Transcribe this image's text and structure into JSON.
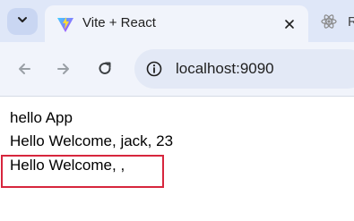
{
  "browser": {
    "active_tab": {
      "title": "Vite + React",
      "favicon": "vite-logo-icon"
    },
    "inactive_tab": {
      "title": "Re",
      "favicon": "react-logo-icon"
    },
    "url": "localhost:9090"
  },
  "page": {
    "lines": [
      "hello App",
      "Hello Welcome, jack, 23",
      "Hello Welcome, ,"
    ],
    "highlight_color": "#d7263d"
  }
}
